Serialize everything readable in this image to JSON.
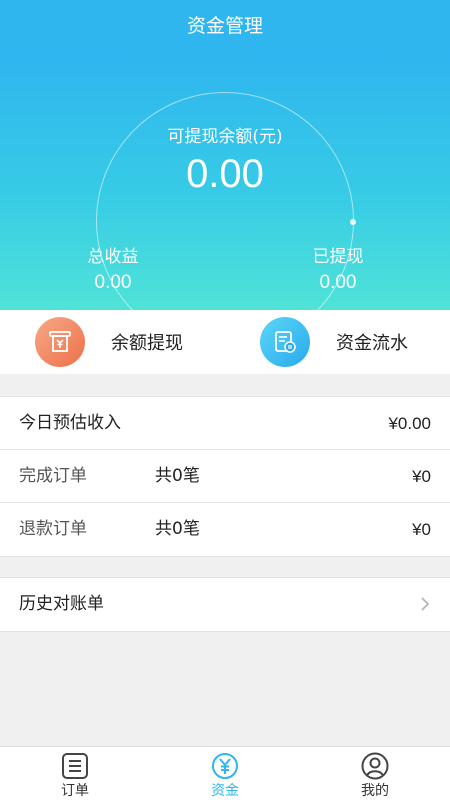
{
  "header": {
    "title": "资金管理"
  },
  "hero": {
    "balance_label": "可提现余额(元)",
    "balance_value": "0.00",
    "total_income_label": "总收益",
    "total_income_value": "0.00",
    "withdrawn_label": "已提现",
    "withdrawn_value": "0.00"
  },
  "actions": {
    "withdraw": {
      "label": "余额提现",
      "icon": "withdraw-icon"
    },
    "flow": {
      "label": "资金流水",
      "icon": "cash-flow-icon"
    }
  },
  "today": {
    "estimate_label": "今日预估收入",
    "estimate_value": "¥0.00",
    "completed": {
      "label": "完成订单",
      "count": "共0笔",
      "amount": "¥0"
    },
    "refund": {
      "label": "退款订单",
      "count": "共0笔",
      "amount": "¥0"
    }
  },
  "history": {
    "label": "历史对账单",
    "icon": "chevron-right-icon"
  },
  "tabbar": {
    "items": [
      {
        "label": "订单",
        "icon": "list-icon",
        "active": false
      },
      {
        "label": "资金",
        "icon": "yen-icon",
        "active": true
      },
      {
        "label": "我的",
        "icon": "user-icon",
        "active": false
      }
    ]
  },
  "colors": {
    "primary": "#2fb6ee",
    "gradient_end": "#4fe3d8",
    "withdraw_icon": "#ee7049",
    "flow_icon": "#2aa9ee"
  }
}
